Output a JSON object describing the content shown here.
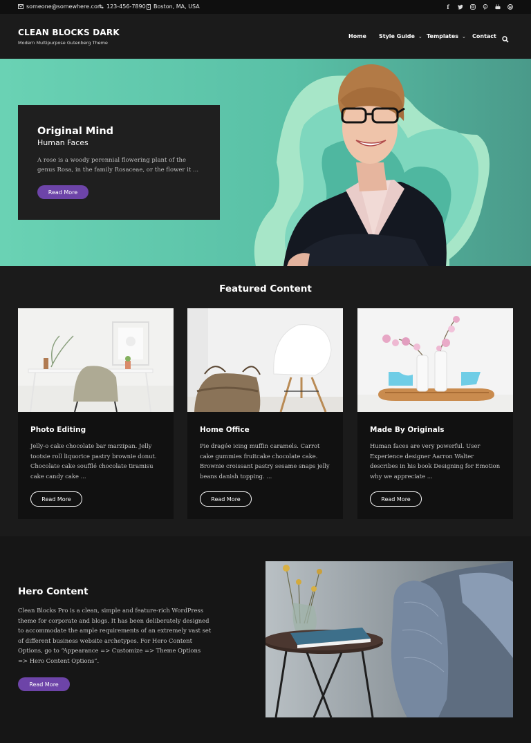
{
  "topbar": {
    "email": "someone@somewhere.com",
    "phone": "123-456-7890",
    "location": "Boston, MA, USA",
    "social": [
      "facebook-icon",
      "twitter-icon",
      "instagram-icon",
      "pinterest-icon",
      "youtube-icon",
      "wordpress-icon"
    ]
  },
  "header": {
    "title": "CLEAN BLOCKS DARK",
    "tagline": "Modern Multipurpose Gutenberg Theme",
    "nav": [
      "Home",
      "Style Guide",
      "Templates",
      "Contact"
    ]
  },
  "hero": {
    "title": "Original Mind",
    "subtitle": "Human Faces",
    "text": "A rose is a woody perennial flowering plant of the genus Rosa, in the family Rosaceae, or the flower it ...",
    "button": "Read More"
  },
  "featured": {
    "title": "Featured Content",
    "items": [
      {
        "title": "Photo Editing",
        "text": "Jelly-o cake chocolate bar marzipan. Jelly tootsie roll liquorice pastry brownie donut. Chocolate cake soufflé chocolate tiramisu cake candy cake ...",
        "button": "Read More"
      },
      {
        "title": "Home Office",
        "text": "Pie dragée icing muffin caramels. Carrot cake gummies fruitcake chocolate cake. Brownie croissant pastry sesame snaps jelly beans danish topping. ...",
        "button": "Read More"
      },
      {
        "title": "Made By Originals",
        "text": "Human faces are very powerful. User Experience designer Aarron Walter describes in his book Designing for Emotion why we appreciate ...",
        "button": "Read More"
      }
    ]
  },
  "hero_content": {
    "title": "Hero Content",
    "text": "Clean Blocks Pro is a clean, simple and feature-rich WordPress theme for corporate and blogs. It has been deliberately designed to accommodate the ample requirements of an extremely vast set of different business website archetypes. For Hero Content Options, go to “Appearance => Customize => Theme Options => Hero Content Options”.",
    "button": "Read More"
  },
  "colors": {
    "accent": "#6d44a8",
    "hero_bg": "#5fc9ad",
    "page_bg": "#1b1b1b"
  }
}
